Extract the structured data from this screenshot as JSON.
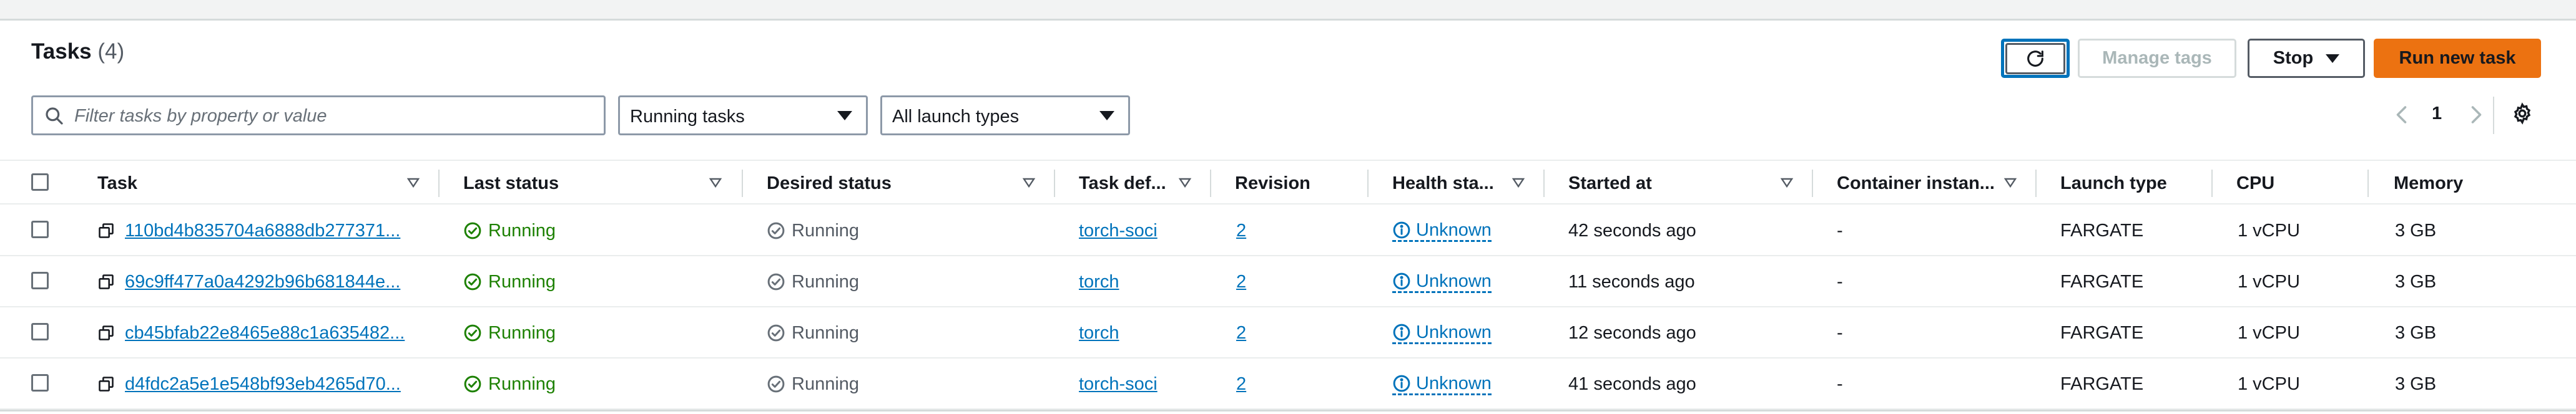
{
  "header": {
    "title": "Tasks",
    "count": "(4)",
    "manage_tags_label": "Manage tags",
    "stop_label": "Stop",
    "run_new_task_label": "Run new task"
  },
  "filters": {
    "search_placeholder": "Filter tasks by property or value",
    "status_selected": "Running tasks",
    "launch_selected": "All launch types"
  },
  "pagination": {
    "current_page": "1"
  },
  "columns": [
    "Task",
    "Last status",
    "Desired status",
    "Task def...",
    "Revision",
    "Health sta...",
    "Started at",
    "Container instan...",
    "Launch type",
    "CPU",
    "Memory"
  ],
  "rows": [
    {
      "task": "110bd4b835704a6888db277371...",
      "last_status": "Running",
      "desired_status": "Running",
      "task_def": "torch-soci",
      "revision": "2",
      "health": "Unknown",
      "started": "42 seconds ago",
      "container": "-",
      "launch": "FARGATE",
      "cpu": "1 vCPU",
      "memory": "3 GB"
    },
    {
      "task": "69c9ff477a0a4292b96b681844e...",
      "last_status": "Running",
      "desired_status": "Running",
      "task_def": "torch",
      "revision": "2",
      "health": "Unknown",
      "started": "11 seconds ago",
      "container": "-",
      "launch": "FARGATE",
      "cpu": "1 vCPU",
      "memory": "3 GB"
    },
    {
      "task": "cb45bfab22e8465e88c1a635482...",
      "last_status": "Running",
      "desired_status": "Running",
      "task_def": "torch",
      "revision": "2",
      "health": "Unknown",
      "started": "12 seconds ago",
      "container": "-",
      "launch": "FARGATE",
      "cpu": "1 vCPU",
      "memory": "3 GB"
    },
    {
      "task": "d4fdc2a5e1e548bf93eb4265d70...",
      "last_status": "Running",
      "desired_status": "Running",
      "task_def": "torch-soci",
      "revision": "2",
      "health": "Unknown",
      "started": "41 seconds ago",
      "container": "-",
      "launch": "FARGATE",
      "cpu": "1 vCPU",
      "memory": "3 GB"
    }
  ],
  "colors": {
    "accent": "#0073bb",
    "primary_button": "#ec7211",
    "success": "#1d8102"
  },
  "icons": [
    "refresh-icon",
    "search-icon",
    "chevron-left-icon",
    "chevron-right-icon",
    "settings-gear-icon",
    "copy-icon",
    "status-success-icon",
    "status-stopped-icon",
    "info-icon",
    "sort-icon",
    "caret-down-icon"
  ]
}
